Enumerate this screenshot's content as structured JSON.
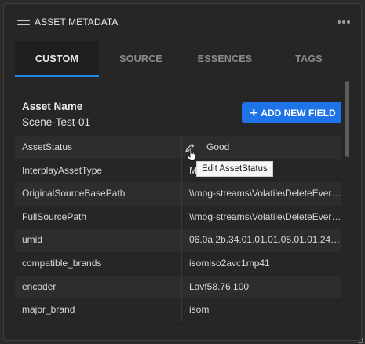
{
  "panel": {
    "title": "ASSET METADATA"
  },
  "tabs": [
    {
      "label": "CUSTOM",
      "active": true
    },
    {
      "label": "SOURCE",
      "active": false
    },
    {
      "label": "ESSENCES",
      "active": false
    },
    {
      "label": "TAGS",
      "active": false
    }
  ],
  "asset": {
    "name_label": "Asset Name",
    "name_value": "Scene-Test-01"
  },
  "add_button": {
    "label": "ADD NEW FIELD",
    "color": "#1e73e8"
  },
  "tooltip": "Edit AssetStatus",
  "rows": [
    {
      "key": "AssetStatus",
      "value": "Good"
    },
    {
      "key": "InterplayAssetType",
      "value": "M"
    },
    {
      "key": "OriginalSourceBasePath",
      "value": "\\\\mog-streams\\Volatile\\DeleteEvery ..."
    },
    {
      "key": "FullSourcePath",
      "value": "\\\\mog-streams\\Volatile\\DeleteEvery ..."
    },
    {
      "key": "umid",
      "value": "06.0a.2b.34.01.01.01.05.01.01.24.47...."
    },
    {
      "key": "compatible_brands",
      "value": "isomiso2avc1mp41"
    },
    {
      "key": "encoder",
      "value": "Lavf58.76.100"
    },
    {
      "key": "major_brand",
      "value": "isom"
    }
  ],
  "icons": {
    "drag": "drag-handle-icon",
    "more": "more-horizontal-icon",
    "pencil": "pencil-icon",
    "cursor": "hand-cursor-icon",
    "resize": "resize-corner-icon"
  },
  "colors": {
    "accent": "#1e88e5",
    "panel_bg": "#262626",
    "row_alt": "#2d2d2d"
  }
}
